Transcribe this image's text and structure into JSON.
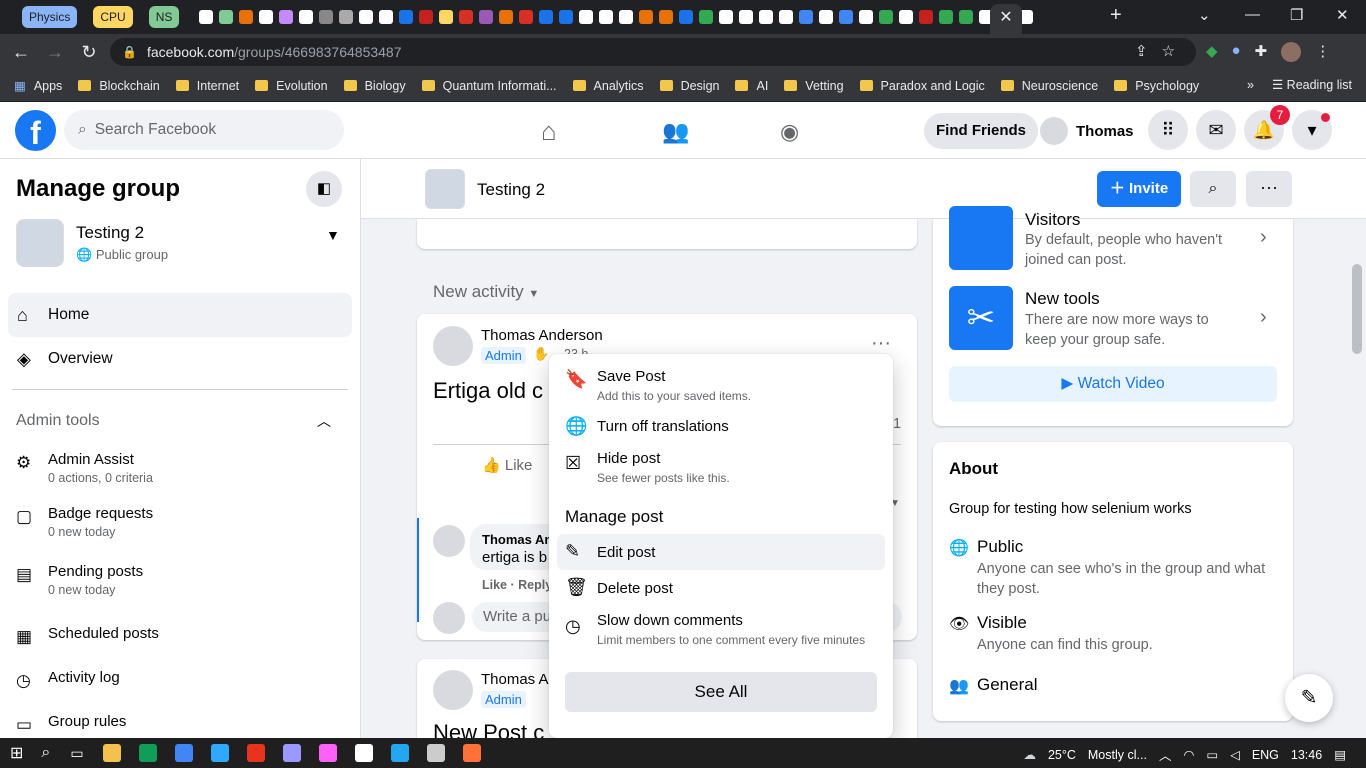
{
  "browser": {
    "tab_groups": [
      {
        "label": "Physics",
        "color": "#8ab4f8",
        "text": "#202124"
      },
      {
        "label": "CPU",
        "color": "#fdd663",
        "text": "#202124"
      },
      {
        "label": "NS",
        "color": "#81c995",
        "text": "#202124"
      }
    ],
    "tab_favicon_colors": [
      "#fff",
      "#81c995",
      "#e8710a",
      "#fff",
      "#c58af9",
      "#fff",
      "#888",
      "#aaa",
      "#fff",
      "#fff",
      "#1a73e8",
      "#c5221f",
      "#fdd663",
      "#d93025",
      "#9b59b6",
      "#e8710a",
      "#d93025",
      "#1a73e8",
      "#1a73e8",
      "#fff",
      "#fff",
      "#fff",
      "#e8710a",
      "#e8710a",
      "#1a73e8",
      "#34a853",
      "#fff",
      "#fff",
      "#fff",
      "#fff",
      "#4285f4",
      "#fff",
      "#4285f4",
      "#fff",
      "#34a853",
      "#fff",
      "#c5221f",
      "#34a853",
      "#34a853",
      "#fff",
      "#fff",
      "#fff"
    ],
    "active_tab_close": "✕",
    "new_tab": "+",
    "url_host": "facebook.com",
    "url_path": "/groups/466983764853487",
    "bookmarks": [
      "Apps",
      "Blockchain",
      "Internet",
      "Evolution",
      "Biology",
      "Quantum Informati...",
      "Analytics",
      "Design",
      "AI",
      "Vetting",
      "Paradox and Logic",
      "Neuroscience",
      "Psychology"
    ],
    "bookmarks_more": "»",
    "reading_list": "Reading list"
  },
  "fb": {
    "logo": "f",
    "search_placeholder": "Search Facebook",
    "find_friends": "Find Friends",
    "user_name": "Thomas",
    "notif_count": "7"
  },
  "sidebar": {
    "title": "Manage group",
    "group_name": "Testing 2",
    "group_privacy": "Public group",
    "nav": [
      {
        "label": "Home",
        "icon": "home-icon"
      },
      {
        "label": "Overview",
        "icon": "layers-icon"
      }
    ],
    "admin_tools_label": "Admin tools",
    "tools": [
      {
        "title": "Admin Assist",
        "sub": "0 actions, 0 criteria"
      },
      {
        "title": "Badge requests",
        "sub": "0 new today"
      },
      {
        "title": "Pending posts",
        "sub": "0 new today"
      },
      {
        "title": "Scheduled posts",
        "sub": ""
      },
      {
        "title": "Activity log",
        "sub": ""
      },
      {
        "title": "Group rules",
        "sub": ""
      }
    ]
  },
  "groupbar": {
    "name": "Testing 2",
    "invite": "Invite"
  },
  "feed": {
    "new_activity": "New activity",
    "post1": {
      "author": "Thomas Anderson",
      "role": "Admin",
      "time": "23 h",
      "text": "Ertiga old c",
      "comment_count": "1",
      "like": "Like",
      "comment_author": "Thomas An",
      "comment_text": "ertiga is b",
      "comment_actions": "Like · Reply",
      "write_placeholder": "Write a pu"
    },
    "post2": {
      "author": "Thomas A",
      "role": "Admin",
      "text": "New Post c"
    }
  },
  "menu": {
    "items": [
      {
        "label": "Save Post",
        "sub": "Add this to your saved items.",
        "icon": "bookmark-icon"
      },
      {
        "label": "Turn off translations",
        "sub": "",
        "icon": "globe-icon"
      },
      {
        "label": "Hide post",
        "sub": "See fewer posts like this.",
        "icon": "hide-icon"
      }
    ],
    "manage_heading": "Manage post",
    "manage_items": [
      {
        "label": "Edit post",
        "sub": "",
        "icon": "pencil-icon"
      },
      {
        "label": "Delete post",
        "sub": "",
        "icon": "trash-icon"
      },
      {
        "label": "Slow down comments",
        "sub": "Limit members to one comment every five minutes",
        "icon": "clock-icon"
      }
    ],
    "see_all": "See All"
  },
  "right": {
    "visitors_title": "Visitors",
    "visitors_text1": "By default, people who haven't",
    "visitors_text2": "joined can post.",
    "newtools_title": "New tools",
    "newtools_text1": "There are now more ways to",
    "newtools_text2": "keep your group safe.",
    "watch_video": "Watch Video",
    "about_title": "About",
    "about_desc": "Group for testing how selenium works",
    "public_title": "Public",
    "public_text1": "Anyone can see who's in the group and what",
    "public_text2": "they post.",
    "visible_title": "Visible",
    "visible_text": "Anyone can find this group.",
    "general_title": "General"
  },
  "taskbar": {
    "app_colors": [
      "#f2c14e",
      "#0f9d58",
      "#4285f4",
      "#31a8ff",
      "#e8341c",
      "#9999ff",
      "#ff61f6",
      "#ffffff",
      "#22a7f0",
      "#cccccc",
      "#ff7139"
    ],
    "temp": "25°C",
    "weather": "Mostly cl...",
    "lang": "ENG",
    "time": "13:46"
  },
  "colors": {
    "accent": "#1877f2",
    "badge": "#e41e3f"
  }
}
